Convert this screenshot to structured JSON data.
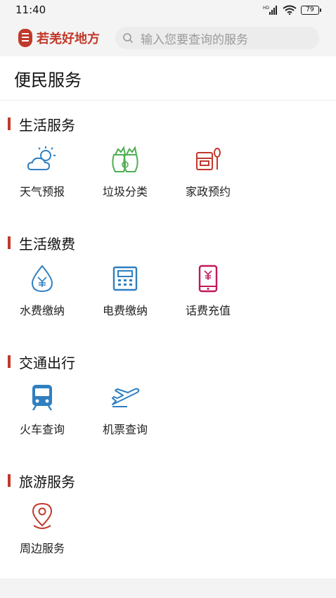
{
  "status_bar": {
    "time": "11:40",
    "battery": "79"
  },
  "header": {
    "app_name": "若羌好地方",
    "search_placeholder": "输入您要查询的服务"
  },
  "page": {
    "title": "便民服务"
  },
  "sections": [
    {
      "title": "生活服务",
      "items": [
        {
          "label": "天气预报",
          "icon": "weather-icon"
        },
        {
          "label": "垃圾分类",
          "icon": "garbage-sort-icon"
        },
        {
          "label": "家政预约",
          "icon": "housekeeping-icon"
        }
      ]
    },
    {
      "title": "生活缴费",
      "items": [
        {
          "label": "水费缴纳",
          "icon": "water-bill-icon"
        },
        {
          "label": "电费缴纳",
          "icon": "electricity-bill-icon"
        },
        {
          "label": "话费充值",
          "icon": "phone-recharge-icon"
        }
      ]
    },
    {
      "title": "交通出行",
      "items": [
        {
          "label": "火车查询",
          "icon": "train-icon"
        },
        {
          "label": "机票查询",
          "icon": "plane-icon"
        }
      ]
    },
    {
      "title": "旅游服务",
      "items": [
        {
          "label": "周边服务",
          "icon": "location-pin-icon"
        }
      ]
    }
  ],
  "colors": {
    "accent": "#c0392b",
    "blue": "#2f7fc1",
    "green": "#4caf50",
    "pink": "#c2185b"
  }
}
